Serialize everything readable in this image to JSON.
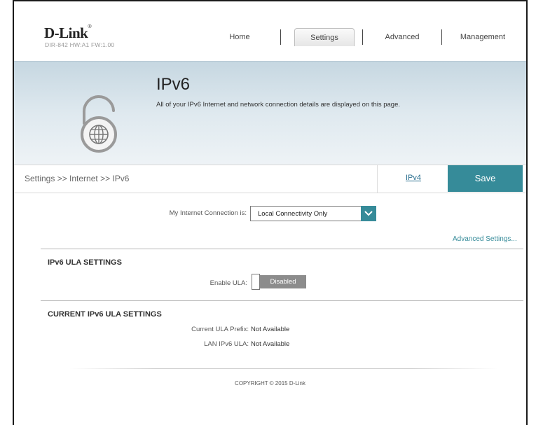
{
  "brand": {
    "logo": "D-Link",
    "model": "DIR-842   HW:A1   FW:1.00"
  },
  "nav": {
    "home": "Home",
    "settings": "Settings",
    "advanced": "Advanced",
    "management": "Management"
  },
  "banner": {
    "title": "IPv6",
    "description": "All of your IPv6 Internet and network connection details are displayed on this page."
  },
  "breadcrumb": "Settings >> Internet >> IPv6",
  "actions": {
    "ipv4_link": "IPv4",
    "save": "Save"
  },
  "connection": {
    "label": "My Internet Connection is:",
    "selected": "Local Connectivity Only"
  },
  "advanced_settings": "Advanced Settings...",
  "ula_settings": {
    "title": "IPv6 ULA SETTINGS",
    "enable_label": "Enable ULA:",
    "enable_state": "Disabled"
  },
  "current_ula": {
    "title": "CURRENT IPv6 ULA SETTINGS",
    "prefix_label": "Current ULA Prefix:",
    "prefix_value": "Not Available",
    "lan_label": "LAN IPv6 ULA:",
    "lan_value": "Not Available"
  },
  "footer": {
    "copyright": "COPYRIGHT © 2015 D-Link"
  },
  "colors": {
    "accent": "#368b99",
    "toggle_off": "#8c8c8c"
  }
}
